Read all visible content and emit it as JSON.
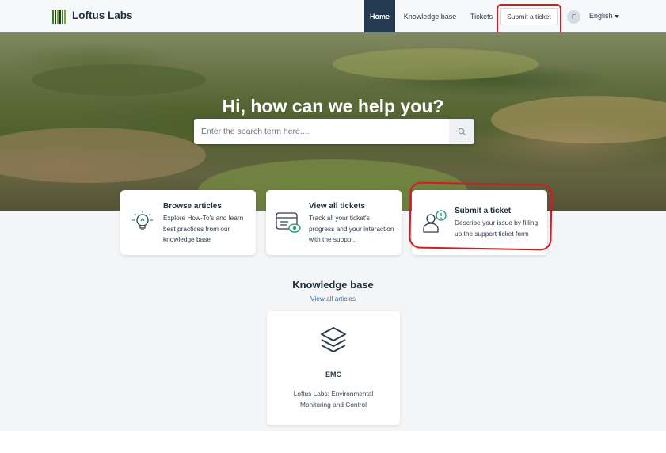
{
  "header": {
    "brand": "Loftus Labs",
    "nav": {
      "home": "Home",
      "knowledge_base": "Knowledge base",
      "tickets": "Tickets",
      "submit_ticket": "Submit a ticket"
    },
    "avatar_initial": "F",
    "language": "English"
  },
  "hero": {
    "title": "Hi, how can we help you?",
    "search_placeholder": "Enter the search term here...."
  },
  "cards": [
    {
      "title": "Browse articles",
      "description": "Explore How-To's and learn best practices from our knowledge base",
      "icon": "lightbulb-icon"
    },
    {
      "title": "View all tickets",
      "description": "Track all your ticket's progress and your interaction with the suppo...",
      "icon": "tickets-view-icon"
    },
    {
      "title": "Submit a ticket",
      "description": "Describe your issue by filling up the support ticket form",
      "icon": "user-alert-icon"
    }
  ],
  "knowledge_base": {
    "title": "Knowledge base",
    "view_all": "View all articles",
    "categories": [
      {
        "name": "EMC",
        "description": "Loftus Labs: Environmental Monitoring and Control",
        "icon": "layers-icon"
      }
    ]
  },
  "colors": {
    "nav_active_bg": "#233a50",
    "annotation": "#d71920",
    "icon_green": "#1d9a6c",
    "link": "#2f6fa8"
  }
}
